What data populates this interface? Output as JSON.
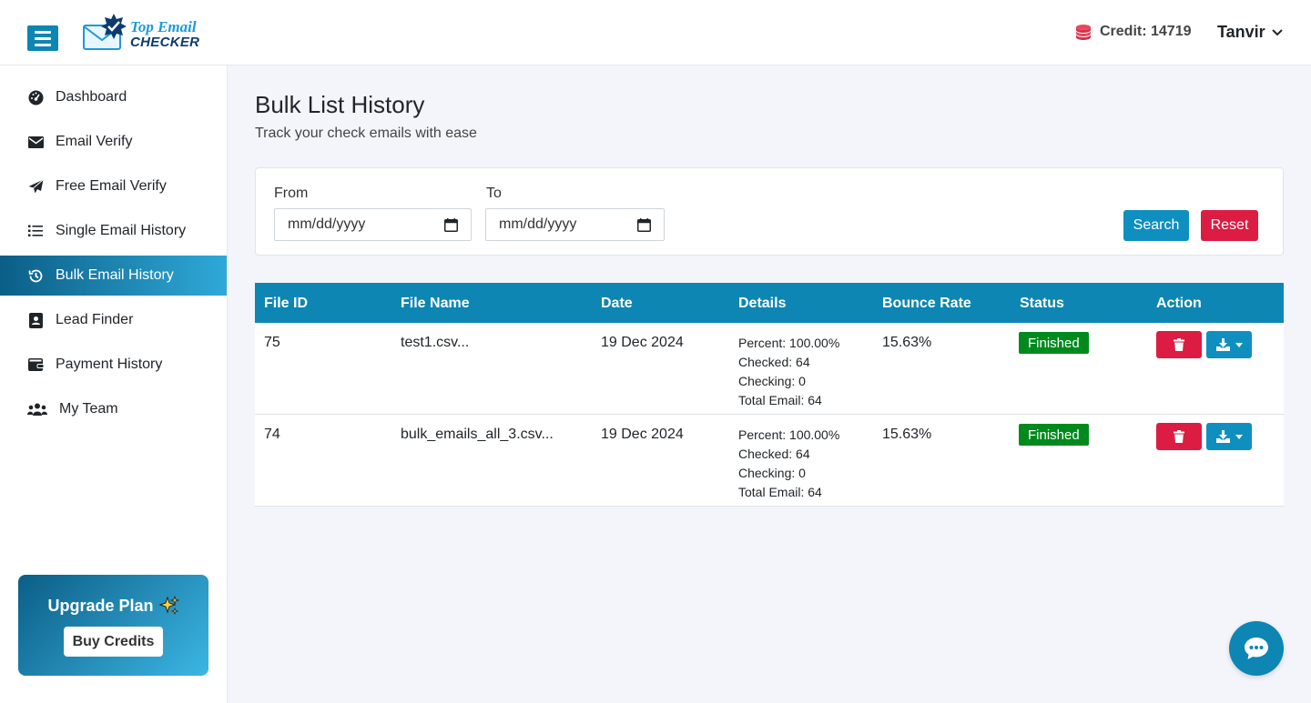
{
  "header": {
    "logo_line1": "Top Email",
    "logo_line2": "CHECKER",
    "credit_label": "Credit: 14719",
    "user_name": "Tanvir",
    "icons": [
      "menu-icon",
      "coins-icon",
      "chevron-down-icon"
    ]
  },
  "sidebar": {
    "items": [
      {
        "label": "Dashboard",
        "icon": "dashboard-icon"
      },
      {
        "label": "Email Verify",
        "icon": "envelope-icon"
      },
      {
        "label": "Free Email Verify",
        "icon": "paper-plane-icon"
      },
      {
        "label": "Single Email History",
        "icon": "list-icon"
      },
      {
        "label": "Bulk Email History",
        "icon": "history-icon",
        "active": true
      },
      {
        "label": "Lead Finder",
        "icon": "address-card-icon"
      },
      {
        "label": "Payment History",
        "icon": "wallet-icon"
      },
      {
        "label": "My Team",
        "icon": "team-icon"
      }
    ],
    "upgrade": {
      "title": "Upgrade Plan",
      "button": "Buy Credits"
    }
  },
  "main": {
    "title": "Bulk List History",
    "subtitle": "Track your check emails with ease",
    "filter": {
      "from_label": "From",
      "to_label": "To",
      "from_value": "mm/dd/yyyy",
      "to_value": "mm/dd/yyyy",
      "search_label": "Search",
      "reset_label": "Reset"
    },
    "table": {
      "headers": [
        "File ID",
        "File Name",
        "Date",
        "Details",
        "Bounce Rate",
        "Status",
        "Action"
      ],
      "rows": [
        {
          "file_id": "75",
          "file_name": "test1.csv...",
          "date": "19 Dec 2024",
          "percent": "Percent: 100.00%",
          "checked": "Checked: 64",
          "checking": "Checking: 0",
          "total": "Total Email: 64",
          "bounce_rate": "15.63%",
          "status": "Finished"
        },
        {
          "file_id": "74",
          "file_name": "bulk_emails_all_3.csv...",
          "date": "19 Dec 2024",
          "percent": "Percent: 100.00%",
          "checked": "Checked: 64",
          "checking": "Checking: 0",
          "total": "Total Email: 64",
          "bounce_rate": "15.63%",
          "status": "Finished"
        }
      ]
    }
  },
  "colors": {
    "primary": "#0d86b3",
    "danger": "#dc1c42",
    "success": "#008a1e",
    "background": "#f4f5fa"
  }
}
